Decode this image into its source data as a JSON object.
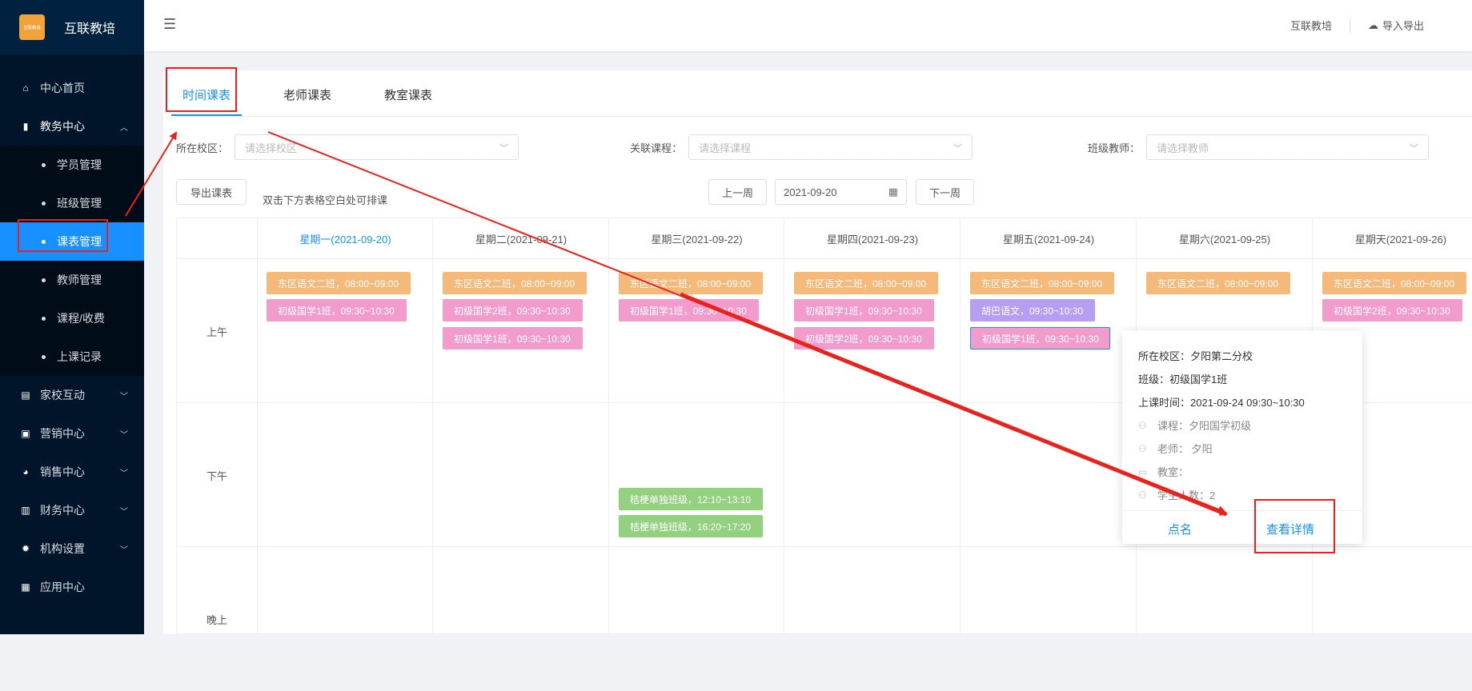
{
  "app": {
    "name": "互联教培",
    "logo_text": "互联教培"
  },
  "sidebar": {
    "items": [
      {
        "label": "中心首页",
        "icon": "home-icon"
      },
      {
        "label": "教务中心",
        "icon": "book-icon",
        "expanded": true
      },
      {
        "label": "家校互动",
        "icon": "chat-icon"
      },
      {
        "label": "营销中心",
        "icon": "bag-icon"
      },
      {
        "label": "销售中心",
        "icon": "user-coin-icon"
      },
      {
        "label": "财务中心",
        "icon": "wallet-icon"
      },
      {
        "label": "机构设置",
        "icon": "gear-icon"
      },
      {
        "label": "应用中心",
        "icon": "grid-icon"
      }
    ],
    "sub_items": [
      {
        "label": "学员管理"
      },
      {
        "label": "班级管理"
      },
      {
        "label": "课表管理",
        "active": true
      },
      {
        "label": "教师管理"
      },
      {
        "label": "课程/收费"
      },
      {
        "label": "上课记录"
      }
    ]
  },
  "header": {
    "org_name": "互联教培",
    "import_export": "导入导出"
  },
  "tabs": [
    {
      "label": "时间课表",
      "active": true
    },
    {
      "label": "老师课表"
    },
    {
      "label": "教室课表"
    }
  ],
  "filters": {
    "campus": {
      "label": "所在校区：",
      "placeholder": "请选择校区"
    },
    "course": {
      "label": "关联课程：",
      "placeholder": "请选择课程"
    },
    "teacher": {
      "label": "班级教师：",
      "placeholder": "请选择教师"
    }
  },
  "toolbar": {
    "export": "导出课表",
    "hint": "双击下方表格空白处可排课",
    "prev_week": "上一周",
    "date": "2021-09-20",
    "next_week": "下一周"
  },
  "days": [
    {
      "label": "星期一(2021-09-20)",
      "today": true
    },
    {
      "label": "星期二(2021-09-21)"
    },
    {
      "label": "星期三(2021-09-22)"
    },
    {
      "label": "星期四(2021-09-23)"
    },
    {
      "label": "星期五(2021-09-24)"
    },
    {
      "label": "星期六(2021-09-25)"
    },
    {
      "label": "星期天(2021-09-26)"
    }
  ],
  "periods": [
    "上午",
    "下午",
    "晚上"
  ],
  "sessions": {
    "mon_am": [
      "东区语文二班，08:00~09:00",
      "初级国学1班，09:30~10:30"
    ],
    "tue_am": [
      "东区语文二班，08:00~09:00",
      "初级国学2班，09:30~10:30",
      "初级国学1班，09:30~10:30"
    ],
    "wed_am": [
      "东区语文二班，08:00~09:00",
      "初级国学1班，09:30~10:30"
    ],
    "thu_am": [
      "东区语文二班，08:00~09:00",
      "初级国学1班，09:30~10:30",
      "初级国学2班，09:30~10:30"
    ],
    "fri_am": [
      "东区语文二班，08:00~09:00",
      "胡巴语文，09:30~10:30",
      "初级国学1班，09:30~10:30"
    ],
    "sat_am": [
      "东区语文二班，08:00~09:00"
    ],
    "sun_am": [
      "东区语文二班，08:00~09:00",
      "初级国学2班，09:30~10:30"
    ],
    "wed_pm": [
      "桔梗单独班级，12:10~13:10",
      "桔梗单独班级，16:20~17:20"
    ]
  },
  "popover": {
    "campus": "所在校区：夕阳第二分校",
    "class": "班级：初级国学1班",
    "time": "上课时间：2021-09-24 09:30~10:30",
    "course": "课程：夕阳国学初级",
    "teacher": "老师： 夕阳",
    "room": "教室：",
    "students": "学生人数：2",
    "roll_call": "点名",
    "details": "查看详情"
  },
  "colors": {
    "primary": "#1890ff",
    "sidebar": "#001529",
    "annotation": "#e8231d"
  }
}
